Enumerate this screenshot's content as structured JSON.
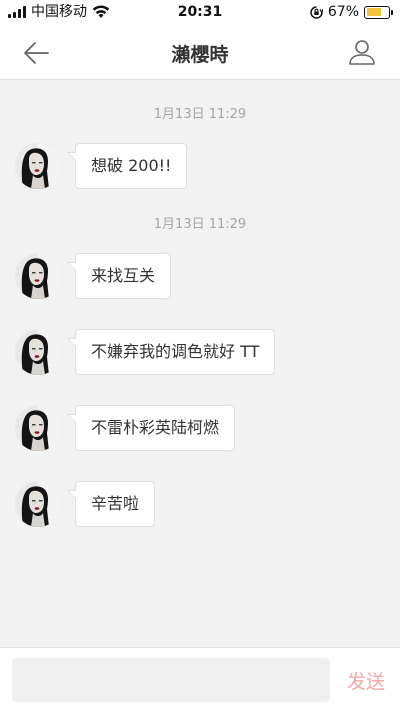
{
  "status_bar": {
    "carrier": "中国移动",
    "time": "20:31",
    "battery_percent": "67%",
    "battery_level": 0.67,
    "battery_color": "#f4c23a",
    "icons": [
      "signal-icon",
      "wifi-icon",
      "rotation-lock-icon",
      "battery-icon"
    ]
  },
  "header": {
    "title": "瀨櫻時",
    "back_icon": "arrow-left-icon",
    "profile_icon": "user-icon"
  },
  "messages": [
    {
      "timestamp": "1月13日 11:29",
      "text": "想破 200!!"
    },
    {
      "timestamp": "1月13日 11:29",
      "text": "来找互关"
    },
    {
      "timestamp": "",
      "text": "不嫌弃我的调色就好 TT"
    },
    {
      "timestamp": "",
      "text": "不雷朴彩英陆柯燃"
    },
    {
      "timestamp": "",
      "text": "辛苦啦"
    }
  ],
  "input": {
    "value": "",
    "placeholder": "",
    "send_label": "发送",
    "send_color": "#f4a7a7"
  }
}
